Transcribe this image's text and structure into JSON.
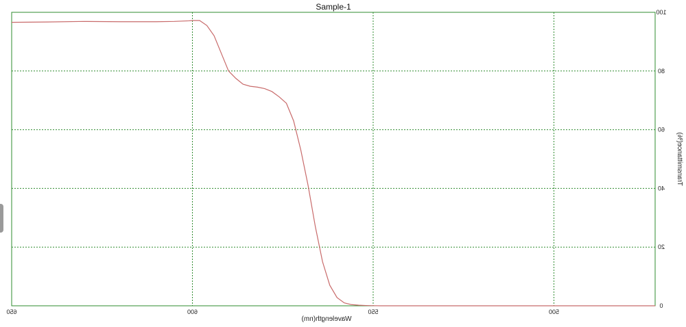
{
  "chart_data": {
    "type": "line",
    "title": "Sample-1",
    "xlabel": "Wavelength(nm)",
    "ylabel": "Transmittance(%)",
    "mirrored": true,
    "xlim": [
      650,
      472
    ],
    "ylim": [
      0,
      100
    ],
    "x_ticks": [
      650,
      600,
      550,
      500
    ],
    "y_ticks": [
      0,
      20,
      40,
      60,
      80,
      100
    ],
    "grid": true,
    "grid_color": "#2e8b2e",
    "frame_color": "#2e8b2e",
    "line_color": "#c86a6a",
    "series": [
      {
        "x": [
          650,
          640,
          630,
          620,
          610,
          605,
          601,
          600,
          598,
          596,
          594,
          592,
          590,
          588,
          586,
          584,
          582,
          580,
          578,
          576,
          574,
          572,
          570,
          568,
          566,
          564,
          562,
          560,
          558,
          556,
          554,
          552,
          550,
          548,
          545,
          540,
          530,
          520,
          510,
          500,
          490,
          480,
          472
        ],
        "y": [
          96.6,
          96.7,
          96.9,
          96.8,
          96.8,
          96.9,
          97.1,
          97.2,
          97.2,
          95.5,
          92.0,
          86.0,
          80.0,
          77.5,
          75.5,
          74.8,
          74.5,
          74.0,
          73.0,
          71.2,
          69.0,
          63.0,
          53.0,
          41.0,
          27.0,
          15.0,
          7.0,
          2.8,
          1.0,
          0.4,
          0.2,
          0.1,
          0.05,
          0.0,
          0.0,
          0.0,
          0.0,
          0.0,
          0.0,
          0.0,
          0.0,
          0.0,
          0.0
        ]
      }
    ]
  }
}
